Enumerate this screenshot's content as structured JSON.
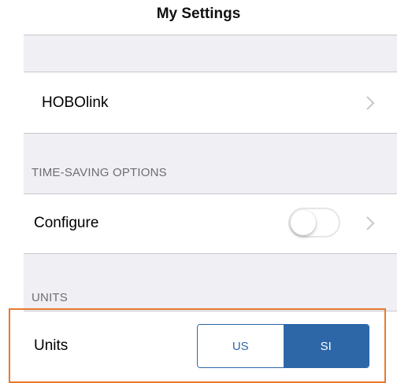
{
  "header": {
    "title": "My Settings"
  },
  "hobolink_row": {
    "label": "HOBOlink",
    "chevron_icon": "chevron-right-icon"
  },
  "time_saving_section": {
    "header": "TIME-SAVING OPTIONS",
    "configure_row": {
      "label": "Configure",
      "toggle_on": false,
      "chevron_icon": "chevron-right-icon"
    }
  },
  "units_section": {
    "header": "UNITS",
    "units_row": {
      "label": "Units",
      "options": [
        "US",
        "SI"
      ],
      "selected": "SI"
    }
  },
  "colors": {
    "accent": "#2d67a8",
    "highlight_border": "#e8792f",
    "group_background": "#efeff4",
    "separator": "#c8c7cc"
  }
}
